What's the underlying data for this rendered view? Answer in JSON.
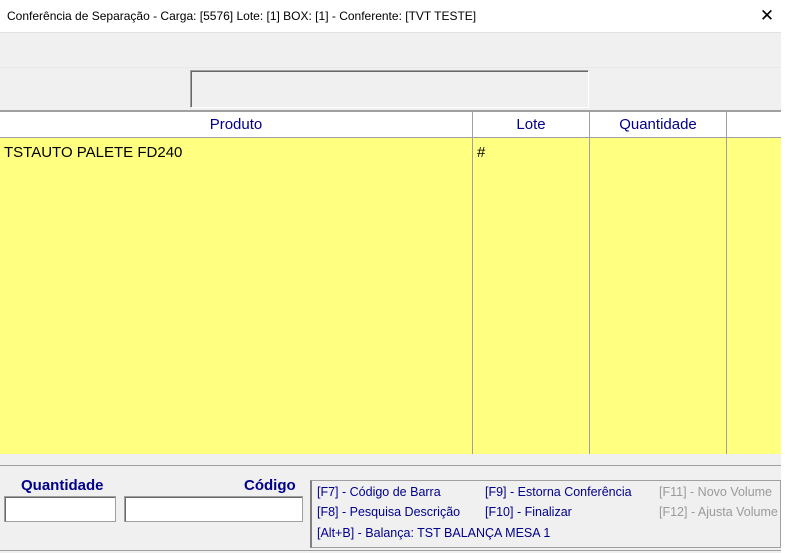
{
  "window": {
    "title": "Conferência de Separação - Carga: [5576] Lote: [1] BOX: [1] - Conferente: [TVT TESTE]",
    "close_glyph": "✕"
  },
  "grid": {
    "columns": [
      "Produto",
      "Lote",
      "Quantidade",
      ""
    ],
    "rows": [
      {
        "produto": "TSTAUTO PALETE FD240",
        "lote": "#",
        "quantidade": ""
      }
    ],
    "colors": {
      "body": "#ffff80",
      "header_text": "#00008b"
    }
  },
  "entry": {
    "quantidade_label": "Quantidade",
    "codigo_label": "Código",
    "quantidade_value": "",
    "codigo_value": ""
  },
  "shortcuts": [
    {
      "label": "[F7] - Código de Barra",
      "enabled": true
    },
    {
      "label": "[F9] - Estorna Conferência",
      "enabled": true
    },
    {
      "label": "[F11] - Novo Volume",
      "enabled": false
    },
    {
      "label": "[F8] - Pesquisa Descrição",
      "enabled": true
    },
    {
      "label": "[F10] - Finalizar",
      "enabled": true
    },
    {
      "label": "[F12] - Ajusta Volume",
      "enabled": false
    },
    {
      "label": "[Alt+B] - Balança: TST BALANÇA MESA 1",
      "enabled": true
    }
  ]
}
